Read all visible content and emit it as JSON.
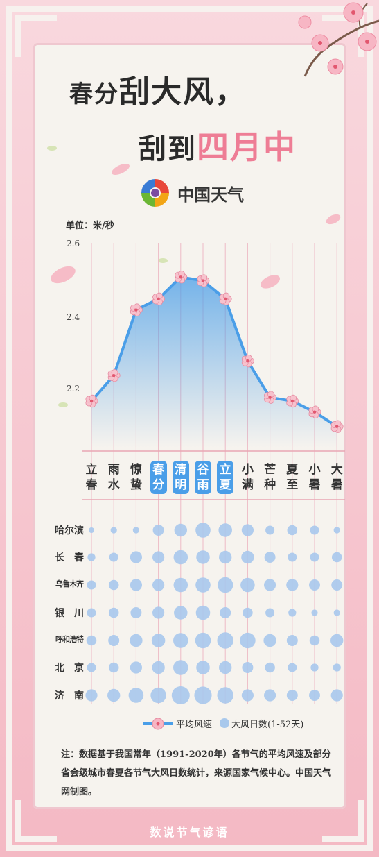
{
  "title": {
    "line1_a": "春分",
    "line1_b": "刮大风，",
    "line2_a": "刮到",
    "line2_b": "四月中"
  },
  "brand": {
    "name": "中国天气"
  },
  "unit_label": "单位：米/秒",
  "colors": {
    "line": "#4a9ee8",
    "accent": "#ee7d95",
    "bubble": "#a8c8ec",
    "highlight": "#4a9ee8"
  },
  "terms": [
    "立春",
    "雨水",
    "惊蛰",
    "春分",
    "清明",
    "谷雨",
    "立夏",
    "小满",
    "芒种",
    "夏至",
    "小暑",
    "大暑"
  ],
  "highlighted_terms": [
    "春分",
    "清明",
    "谷雨",
    "立夏"
  ],
  "cities": [
    "哈尔滨",
    "长　春",
    "乌鲁木齐",
    "银　川",
    "呼和浩特",
    "北　京",
    "济　南"
  ],
  "legend": {
    "line_label": "平均风速",
    "bubble_label": "大风日数(1-52天)"
  },
  "note": "注：数据基于我国常年（1991-2020年）各节气的平均风速及部分省会级城市春夏各节气大风日数统计，来源国家气候中心。中国天气网制图。",
  "footer": "数说节气谚语",
  "chart_data": {
    "type": "line",
    "categories": [
      "立春",
      "雨水",
      "惊蛰",
      "春分",
      "清明",
      "谷雨",
      "立夏",
      "小满",
      "芒种",
      "夏至",
      "小暑",
      "大暑"
    ],
    "series": [
      {
        "name": "平均风速",
        "values": [
          2.17,
          2.24,
          2.42,
          2.45,
          2.51,
          2.5,
          2.45,
          2.28,
          2.18,
          2.17,
          2.14,
          2.1
        ]
      }
    ],
    "ylim": [
      2.05,
      2.6
    ],
    "yticks": [
      "2.2",
      "2.4",
      "2.6"
    ],
    "ylabel": "单位：米/秒",
    "bubbles": {
      "label": "大风日数(1-52天)",
      "rows": [
        [
          3,
          4,
          4,
          12,
          16,
          22,
          18,
          14,
          8,
          10,
          8,
          4
        ],
        [
          6,
          8,
          14,
          14,
          20,
          18,
          16,
          16,
          12,
          8,
          8,
          10
        ],
        [
          8,
          10,
          14,
          14,
          20,
          22,
          24,
          20,
          14,
          14,
          12,
          12
        ],
        [
          8,
          10,
          12,
          14,
          18,
          20,
          12,
          10,
          8,
          6,
          4,
          4
        ],
        [
          10,
          12,
          16,
          18,
          22,
          24,
          26,
          24,
          16,
          12,
          10,
          16
        ],
        [
          8,
          10,
          14,
          16,
          22,
          18,
          16,
          12,
          10,
          8,
          6,
          6
        ],
        [
          14,
          16,
          22,
          24,
          32,
          30,
          26,
          14,
          14,
          12,
          12,
          14
        ]
      ]
    }
  }
}
